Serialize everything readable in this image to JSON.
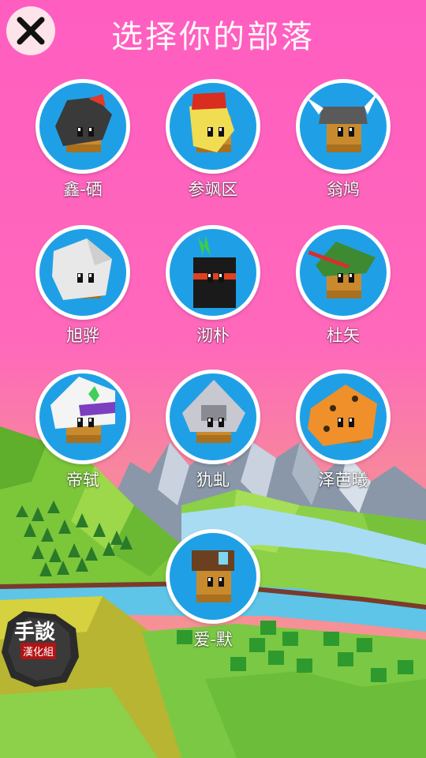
{
  "title": "选择你的部落",
  "close_icon": "close-icon",
  "tribes": [
    {
      "name": "鑫-硒",
      "helmet": "#3a3a3a",
      "accent": "#e03a2a"
    },
    {
      "name": "参飒区",
      "helmet": "#f0dd52",
      "accent": "#d92d20"
    },
    {
      "name": "翁鸠",
      "helmet": "#5a5a5a",
      "accent": "#ffffff"
    },
    {
      "name": "旭骅",
      "helmet": "#e8e8e8",
      "accent": "#cfcfcf"
    },
    {
      "name": "沏朴",
      "helmet": "#1a1a1a",
      "accent": "#3ecf3e"
    },
    {
      "name": "杜矢",
      "helmet": "#3d8a32",
      "accent": "#d43030"
    },
    {
      "name": "帝轼",
      "helmet": "#f4f4f4",
      "accent": "#7c3fbf"
    },
    {
      "name": "犰虬",
      "helmet": "#c8c8d0",
      "accent": "#f0c040"
    },
    {
      "name": "泽芭曦",
      "helmet": "#f0902a",
      "accent": "#3a2a10"
    },
    {
      "name": "爱-默",
      "helmet": "#6b4020",
      "accent": "#7ed6f0"
    }
  ],
  "watermark": {
    "line1": "手談",
    "line2": "漢化組"
  },
  "colors": {
    "sky_top": "#ff5ec0",
    "sky_bottom": "#f58a9a",
    "disc": "#1fa0e6",
    "grass": "#7cc63a",
    "river": "#5ec5e8"
  }
}
